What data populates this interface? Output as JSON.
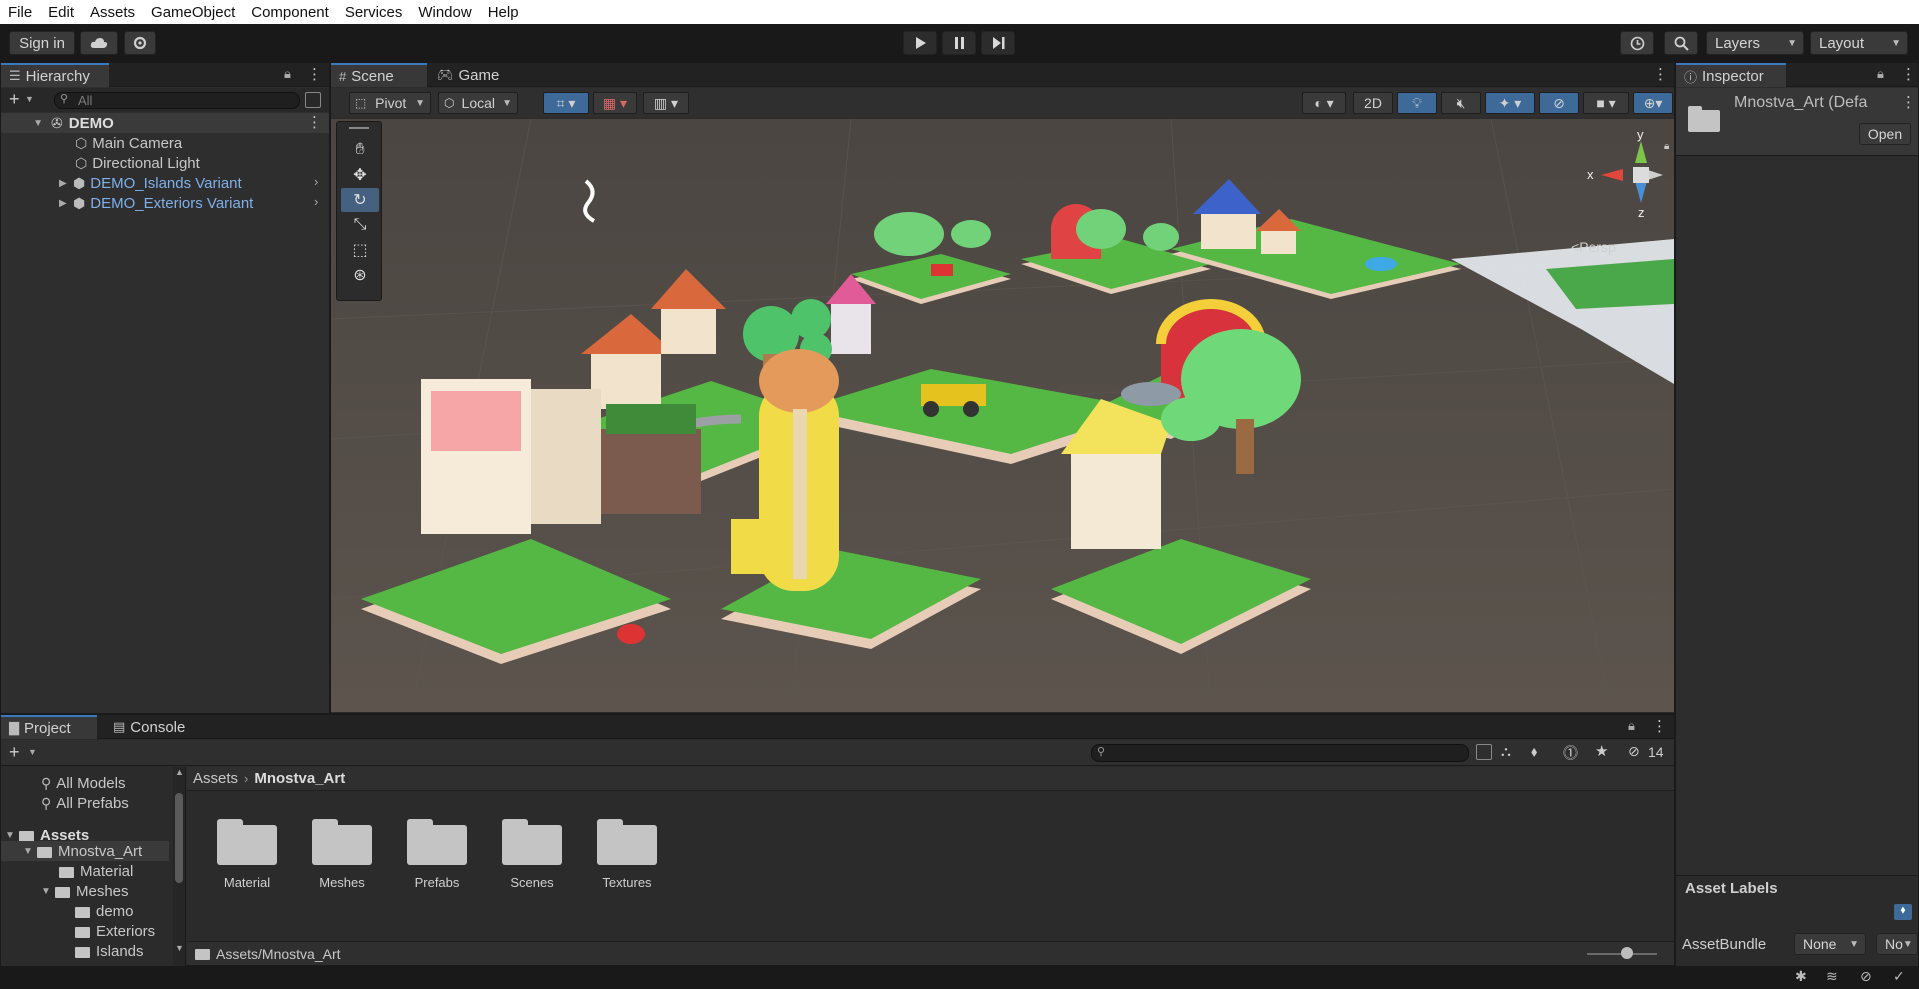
{
  "menu": [
    "File",
    "Edit",
    "Assets",
    "GameObject",
    "Component",
    "Services",
    "Window",
    "Help"
  ],
  "toolbar": {
    "sign_in": "Sign in",
    "layers": "Layers",
    "layout": "Layout",
    "cloud_icon": "cloud-icon",
    "collab_icon": "gear-icon",
    "play_icon": "play-icon",
    "pause_icon": "pause-icon",
    "step_icon": "step-icon"
  },
  "hierarchy": {
    "tab": "Hierarchy",
    "search_placeholder": "All",
    "scene": "DEMO",
    "items": [
      {
        "label": "Main Camera",
        "prefab": false
      },
      {
        "label": "Directional Light",
        "prefab": false
      },
      {
        "label": "DEMO_Islands Variant",
        "prefab": true
      },
      {
        "label": "DEMO_Exteriors Variant",
        "prefab": true
      }
    ]
  },
  "scene": {
    "tabs": [
      "Scene",
      "Game"
    ],
    "pivot": "Pivot",
    "local": "Local",
    "mode_2d": "2D",
    "persp": "Persp",
    "gizmo_axes": {
      "x": "x",
      "y": "y",
      "z": "z"
    }
  },
  "inspector": {
    "tab": "Inspector",
    "asset_name": "Mnostva_Art (Defa",
    "open_button": "Open",
    "asset_labels": "Asset Labels",
    "assetbundle_label": "AssetBundle",
    "assetbundle_value": "None",
    "variant_value": "No"
  },
  "project": {
    "tabs": [
      "Project",
      "Console"
    ],
    "hidden_count": "14",
    "favorites": [
      "All Models",
      "All Prefabs"
    ],
    "tree": {
      "root": "Assets",
      "selected": "Mnostva_Art",
      "children": [
        "Material",
        "Meshes"
      ],
      "mesh_children": [
        "demo",
        "Exteriors",
        "Islands"
      ]
    },
    "breadcrumb": [
      "Assets",
      "Mnostva_Art"
    ],
    "folders": [
      "Material",
      "Meshes",
      "Prefabs",
      "Scenes",
      "Textures"
    ],
    "path": "Assets/Mnostva_Art"
  },
  "colors": {
    "menubar_bg": "#ffffff",
    "editor_bg": "#191919",
    "panel_bg": "#2e2e2e",
    "accent_blue": "#3a79bb",
    "prefab_text": "#7fb0ea",
    "scene_ground": "#5a524c"
  }
}
